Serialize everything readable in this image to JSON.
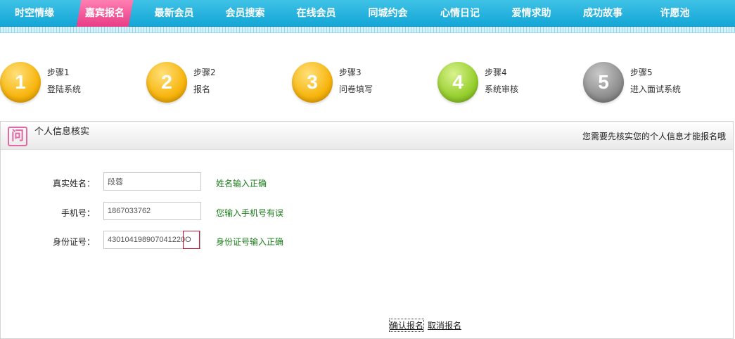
{
  "nav": {
    "items": [
      {
        "label": "时空情缘"
      },
      {
        "label": "嘉宾报名",
        "active": true
      },
      {
        "label": "最新会员"
      },
      {
        "label": "会员搜索"
      },
      {
        "label": "在线会员"
      },
      {
        "label": "同城约会"
      },
      {
        "label": "心情日记"
      },
      {
        "label": "爱情求助"
      },
      {
        "label": "成功故事"
      },
      {
        "label": "许愿池"
      }
    ]
  },
  "steps": [
    {
      "number": "1",
      "title": "步骤1",
      "desc": "登陆系统",
      "color": "#f7b50e"
    },
    {
      "number": "2",
      "title": "步骤2",
      "desc": "报名",
      "color": "#f7b50e"
    },
    {
      "number": "3",
      "title": "步骤3",
      "desc": "问卷填写",
      "color": "#f7b50e"
    },
    {
      "number": "4",
      "title": "步骤4",
      "desc": "系统审核",
      "color": "#97cf2e"
    },
    {
      "number": "5",
      "title": "步骤5",
      "desc": "进入面试系统",
      "color": "#8f8f8f"
    }
  ],
  "panel": {
    "icon_glyph": "问",
    "title": "个人信息核实",
    "note": "您需要先核实您的个人信息才能报名哦"
  },
  "form": {
    "name_label": "真实姓名：",
    "name_value": "段蓉",
    "name_msg": "姓名输入正确",
    "phone_label": "手机号：",
    "phone_value": "1867033762",
    "phone_msg": "您输入手机号有误",
    "id_label": "身份证号：",
    "id_value": "430104198907041220O",
    "id_msg": "身份证号输入正确"
  },
  "actions": {
    "confirm_label": "确认报名",
    "cancel_label": "取消报名"
  },
  "colors": {
    "nav_bg": "#14a6d6",
    "nav_active": "#e83c87",
    "msg_green": "#1a7a1a"
  }
}
